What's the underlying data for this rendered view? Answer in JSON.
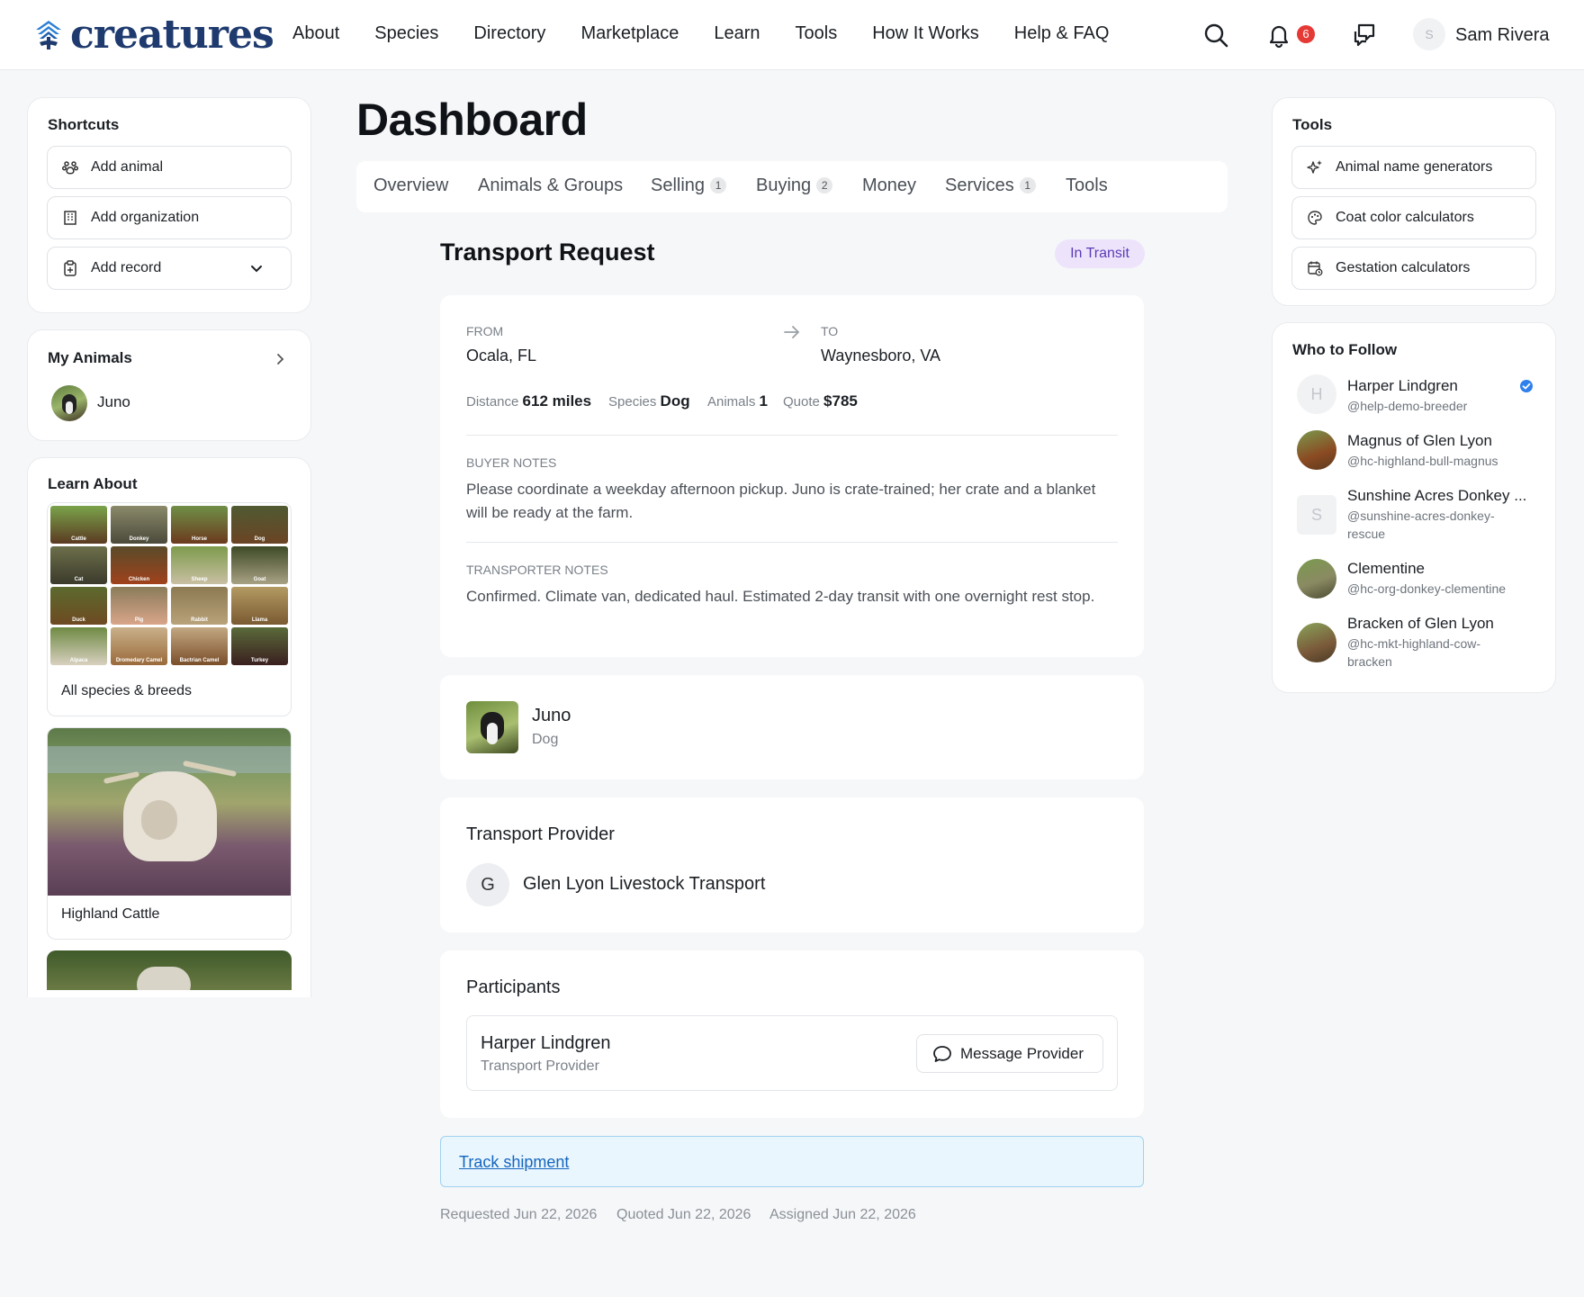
{
  "header": {
    "brand": "creatures",
    "nav": [
      "About",
      "Species",
      "Directory",
      "Marketplace",
      "Learn",
      "Tools",
      "How It Works",
      "Help & FAQ"
    ],
    "notification_count": "6",
    "user_initial": "S",
    "user_name": "Sam Rivera"
  },
  "shortcuts": {
    "title": "Shortcuts",
    "items": [
      "Add animal",
      "Add organization",
      "Add record"
    ]
  },
  "my_animals": {
    "title": "My Animals",
    "items": [
      "Juno"
    ]
  },
  "learn_about": {
    "title": "Learn About",
    "species": [
      "Cattle",
      "Donkey",
      "Horse",
      "Dog",
      "Cat",
      "Chicken",
      "Sheep",
      "Goat",
      "Duck",
      "Pig",
      "Rabbit",
      "Llama",
      "Alpaca",
      "Dromedary Camel",
      "Bactrian Camel",
      "Turkey"
    ],
    "all_link": "All species & breeds",
    "featured": "Highland Cattle"
  },
  "main": {
    "page_title": "Dashboard",
    "tabs": [
      {
        "label": "Overview",
        "count": ""
      },
      {
        "label": "Animals & Groups",
        "count": ""
      },
      {
        "label": "Selling",
        "count": "1"
      },
      {
        "label": "Buying",
        "count": "2"
      },
      {
        "label": "Money",
        "count": ""
      },
      {
        "label": "Services",
        "count": "1"
      },
      {
        "label": "Tools",
        "count": ""
      }
    ],
    "transport": {
      "title": "Transport Request",
      "status": "In Transit",
      "from_label": "FROM",
      "from": "Ocala, FL",
      "to_label": "TO",
      "to": "Waynesboro, VA",
      "distance_label": "Distance",
      "distance": "612 miles",
      "species_label": "Species",
      "species": "Dog",
      "animals_label": "Animals",
      "animals": "1",
      "quote_label": "Quote",
      "quote": "$785",
      "buyer_notes_label": "BUYER NOTES",
      "buyer_notes": "Please coordinate a weekday afternoon pickup. Juno is crate-trained; her crate and a blanket will be ready at the farm.",
      "transporter_notes_label": "TRANSPORTER NOTES",
      "transporter_notes": "Confirmed. Climate van, dedicated haul. Estimated 2-day transit with one overnight rest stop."
    },
    "animal": {
      "name": "Juno",
      "species": "Dog"
    },
    "provider": {
      "title": "Transport Provider",
      "initial": "G",
      "name": "Glen Lyon Livestock Transport"
    },
    "participants": {
      "title": "Participants",
      "name": "Harper Lindgren",
      "role": "Transport Provider",
      "button": "Message Provider"
    },
    "track_link": "Track shipment",
    "dates": [
      "Requested Jun 22, 2026",
      "Quoted Jun 22, 2026",
      "Assigned Jun 22, 2026"
    ]
  },
  "tools": {
    "title": "Tools",
    "items": [
      "Animal name generators",
      "Coat color calculators",
      "Gestation calculators"
    ]
  },
  "who_to_follow": {
    "title": "Who to Follow",
    "people": [
      {
        "name": "Harper Lindgren",
        "handle": "@help-demo-breeder",
        "initial": "H"
      },
      {
        "name": "Magnus of Glen Lyon",
        "handle": "@hc-highland-bull-magnus",
        "initial": ""
      },
      {
        "name": "Sunshine Acres Donkey ...",
        "handle": "@sunshine-acres-donkey-rescue",
        "initial": "S"
      },
      {
        "name": "Clementine",
        "handle": "@hc-org-donkey-clementine",
        "initial": ""
      },
      {
        "name": "Bracken of Glen Lyon",
        "handle": "@hc-mkt-highland-cow-bracken",
        "initial": ""
      }
    ]
  },
  "colors": {
    "brand": "#1e3a6e",
    "badge": "#e53935",
    "status_pill_bg": "#ede4fb",
    "status_pill_text": "#5b3bb5",
    "link": "#1565c0",
    "verified": "#2f80ed"
  },
  "icons": [
    "search-icon",
    "bell-icon",
    "chat-icon",
    "paw-icon",
    "building-icon",
    "clipboard-icon",
    "chevron-down-icon",
    "chevron-right-icon",
    "arrow-right-icon",
    "sparkle-icon",
    "palette-icon",
    "calendar-icon",
    "message-icon",
    "verified-icon"
  ]
}
